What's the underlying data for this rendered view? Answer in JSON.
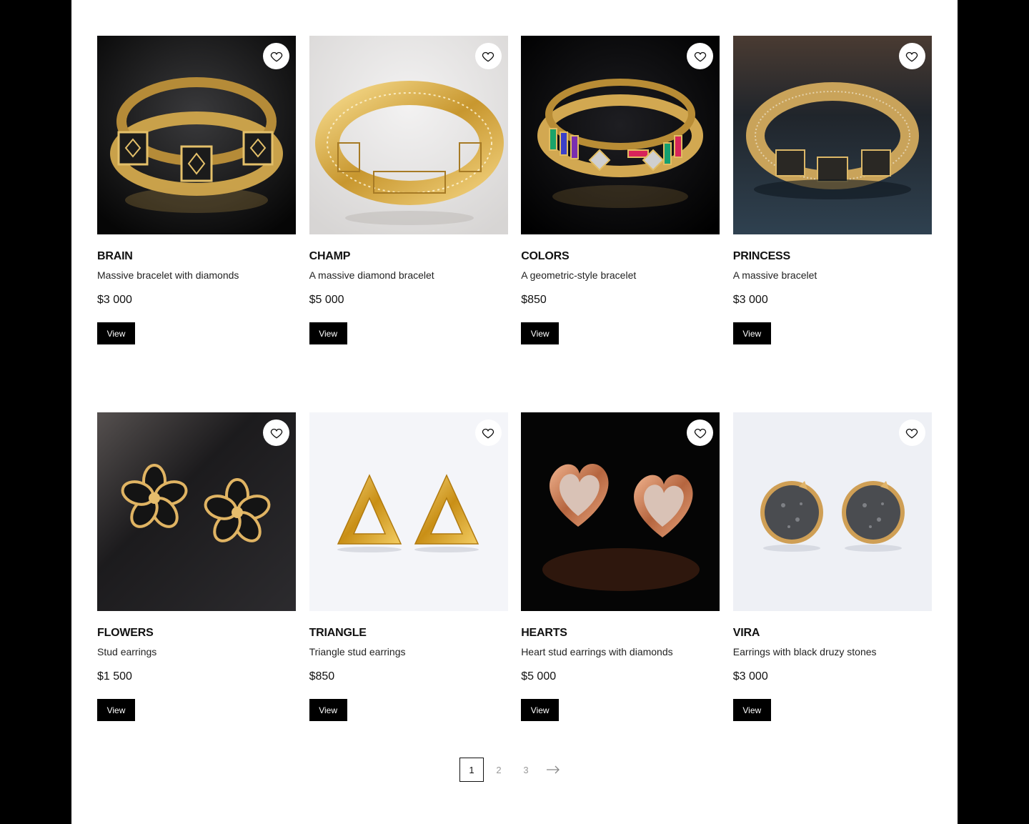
{
  "products": [
    {
      "name": "BRAIN",
      "description": "Massive bracelet with diamonds",
      "price": "$3 000",
      "button": "View",
      "image": "bracelet-gold-black-squares"
    },
    {
      "name": "CHAMP",
      "description": "A massive diamond bracelet",
      "price": "$5 000",
      "button": "View",
      "image": "bracelet-gold-diamond-pave"
    },
    {
      "name": "COLORS",
      "description": "A geometric-style bracelet",
      "price": "$850",
      "button": "View",
      "image": "bracelet-gold-colored-stones"
    },
    {
      "name": "PRINCESS",
      "description": "A massive bracelet",
      "price": "$3 000",
      "button": "View",
      "image": "bracelet-gold-pave-links"
    },
    {
      "name": "FLOWERS",
      "description": "Stud earrings",
      "price": "$1 500",
      "button": "View",
      "image": "earrings-flower-black-enamel"
    },
    {
      "name": "TRIANGLE",
      "description": "Triangle stud earrings",
      "price": "$850",
      "button": "View",
      "image": "earrings-gold-triangle"
    },
    {
      "name": "HEARTS",
      "description": "Heart stud earrings with diamonds",
      "price": "$5 000",
      "button": "View",
      "image": "earrings-rose-gold-heart"
    },
    {
      "name": "VIRA",
      "description": "Earrings with black druzy stones",
      "price": "$3 000",
      "button": "View",
      "image": "earrings-black-druzy"
    }
  ],
  "favorite_icon": "heart-outline-icon",
  "pagination": {
    "pages": [
      "1",
      "2",
      "3"
    ],
    "current": "1",
    "next_icon": "arrow-right-icon"
  },
  "colors": {
    "page_background": "#ffffff",
    "outer_background": "#000000",
    "button_background": "#000000",
    "button_text": "#ffffff",
    "gold": "#d4a64a"
  }
}
